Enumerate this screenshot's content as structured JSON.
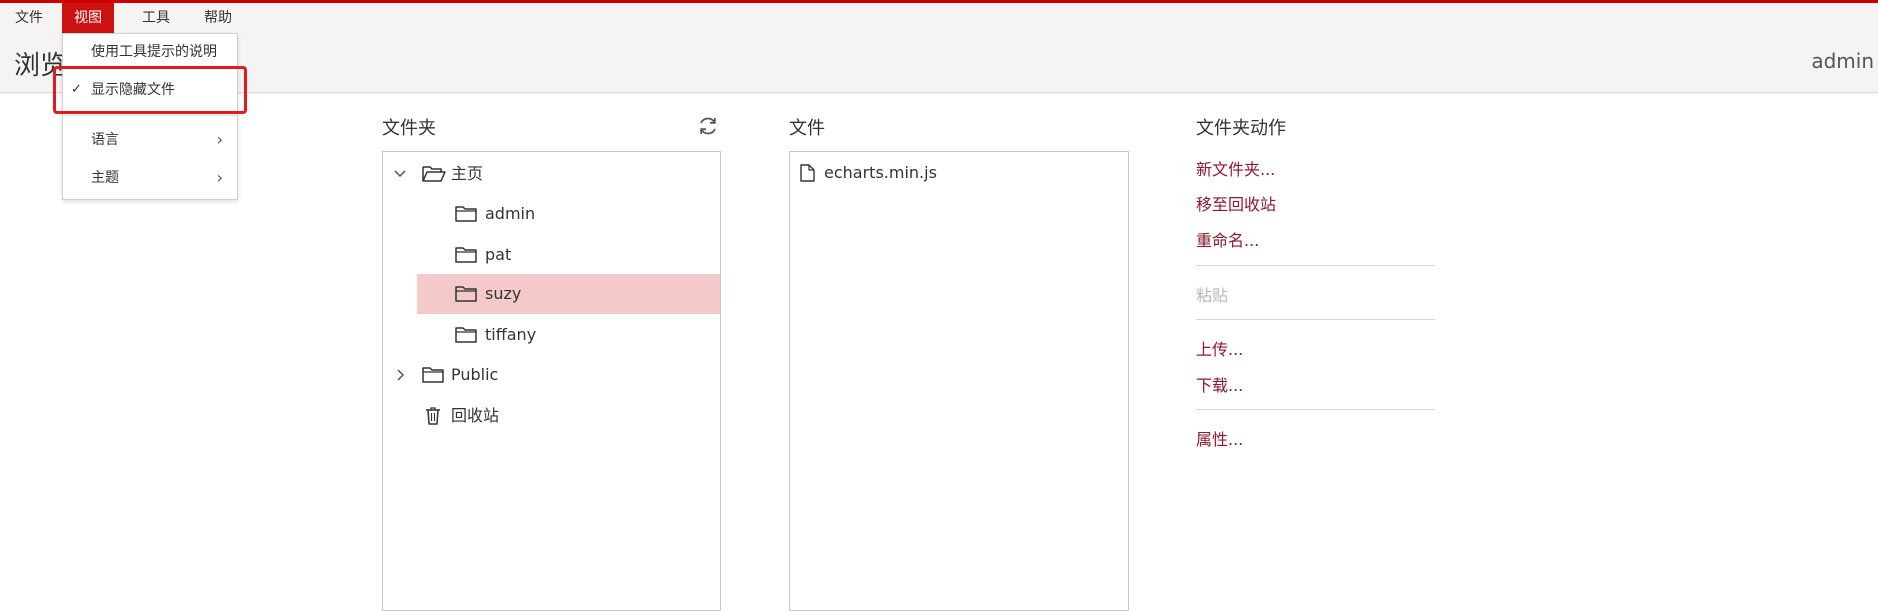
{
  "menubar": {
    "items": [
      {
        "label": "文件"
      },
      {
        "label": "视图"
      },
      {
        "label": "工具"
      },
      {
        "label": "帮助"
      }
    ]
  },
  "header": {
    "title": "浏览",
    "user": "admin"
  },
  "view_menu": {
    "items": [
      {
        "label": "使用工具提示的说明",
        "checked": false
      },
      {
        "label": "显示隐藏文件",
        "checked": true
      },
      {
        "label": "语言",
        "submenu": true
      },
      {
        "label": "主题",
        "submenu": true
      }
    ],
    "check_glyph": "✓",
    "arrow_glyph": "›"
  },
  "folders_panel": {
    "title": "文件夹",
    "tree": [
      {
        "label": "主页",
        "expanded": true,
        "icon": "folder-open-icon"
      },
      {
        "label": "admin",
        "icon": "folder-icon"
      },
      {
        "label": "pat",
        "icon": "folder-icon"
      },
      {
        "label": "suzy",
        "icon": "folder-icon",
        "selected": true
      },
      {
        "label": "tiffany",
        "icon": "folder-icon"
      },
      {
        "label": "Public",
        "expanded": false,
        "icon": "folder-icon"
      },
      {
        "label": "回收站",
        "icon": "trash-icon"
      }
    ]
  },
  "files_panel": {
    "title": "文件",
    "files": [
      {
        "name": "echarts.min.js",
        "icon": "file-icon"
      }
    ]
  },
  "actions_panel": {
    "title": "文件夹动作",
    "items": [
      {
        "label": "新文件夹..."
      },
      {
        "label": "移至回收站"
      },
      {
        "label": "重命名..."
      },
      {
        "label": "粘贴",
        "disabled": true
      },
      {
        "label": "上传..."
      },
      {
        "label": "下载..."
      },
      {
        "label": "属性..."
      }
    ]
  },
  "colors": {
    "accent": "#cc1111",
    "selection": "#f4c9c9",
    "action_link": "#8b1a2e",
    "highlight_box": "#e21b1b"
  }
}
